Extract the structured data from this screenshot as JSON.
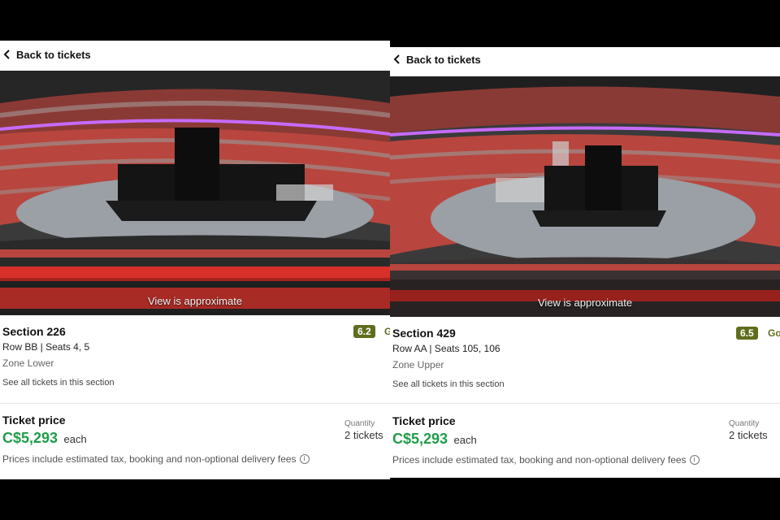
{
  "panels": [
    {
      "back_label": "Back to tickets",
      "view_caption": "View is approximate",
      "section": "Section 226",
      "row_seats": "Row BB | Seats 4, 5",
      "zone": "Zone Lower",
      "see_all": "See all tickets in this section",
      "score": "6.2",
      "score_label": "G",
      "ticket_price_label": "Ticket price",
      "price": "C$5,293",
      "each": "each",
      "quantity_label": "Quantity",
      "quantity": "2 tickets",
      "fees_note": "Prices include estimated tax, booking and non-optional delivery fees",
      "info_icon": "i"
    },
    {
      "back_label": "Back to tickets",
      "view_caption": "View is approximate",
      "section": "Section 429",
      "row_seats": "Row AA | Seats 105, 106",
      "zone": "Zone Upper",
      "see_all": "See all tickets in this section",
      "score": "6.5",
      "score_label": "Go",
      "ticket_price_label": "Ticket price",
      "price": "C$5,293",
      "each": "each",
      "quantity_label": "Quantity",
      "quantity": "2 tickets",
      "fees_note": "Prices include estimated tax, booking and non-optional delivery fees",
      "info_icon": "i"
    }
  ],
  "colors": {
    "score_badge": "#5f6e1d",
    "price_green": "#1f9d49",
    "seat_red": "#d8312a",
    "stage_black": "#141414",
    "neon_purple": "#c66bff"
  }
}
